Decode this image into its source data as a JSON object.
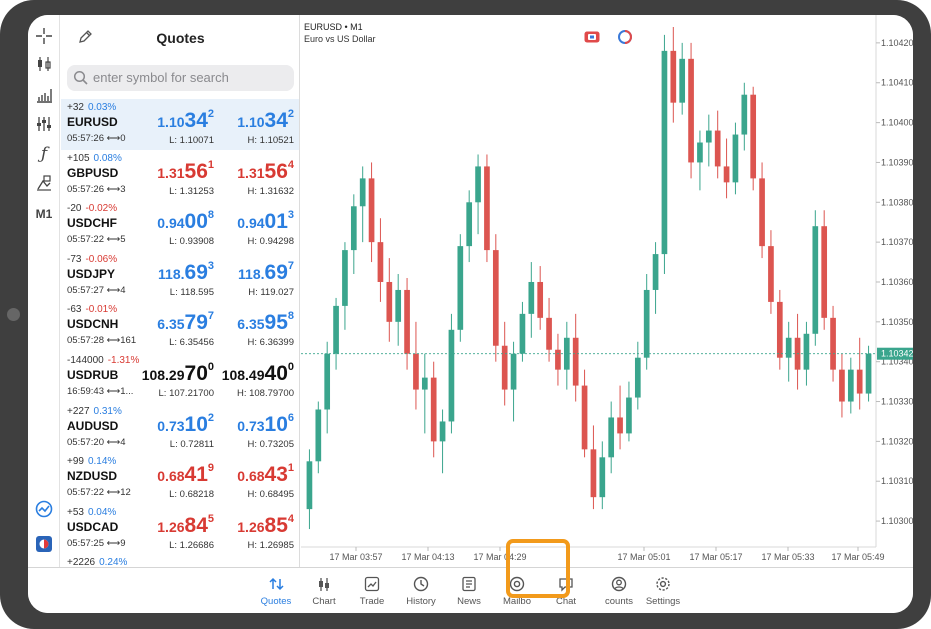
{
  "toolbar_icons": [
    "crosshair-icon",
    "candlestick-icon",
    "bar-chart-icon",
    "indicators-icon",
    "function-icon",
    "objects-icon",
    "timeframe-label"
  ],
  "timeframe": "M1",
  "side_bottom_icons": [
    "trading-signals-icon",
    "broker-icon"
  ],
  "quotes": {
    "title": "Quotes",
    "search_placeholder": "enter symbol for search",
    "rows": [
      {
        "change": "+32",
        "pct": "0.03%",
        "pct_color": "#2a7ee0",
        "symbol": "EURUSD",
        "time": "05:57:26",
        "spread": "0",
        "bid_a": "1.10",
        "bid_b": "34",
        "bid_c": "2",
        "ask_a": "1.10",
        "ask_b": "34",
        "ask_c": "2",
        "color": "blue",
        "low": "L: 1.10071",
        "high": "H: 1.10521"
      },
      {
        "change": "+105",
        "pct": "0.08%",
        "pct_color": "#2a7ee0",
        "symbol": "GBPUSD",
        "time": "05:57:26",
        "spread": "3",
        "bid_a": "1.31",
        "bid_b": "56",
        "bid_c": "1",
        "ask_a": "1.31",
        "ask_b": "56",
        "ask_c": "4",
        "color": "red",
        "low": "L: 1.31253",
        "high": "H: 1.31632"
      },
      {
        "change": "-20",
        "pct": "-0.02%",
        "pct_color": "#d83a33",
        "symbol": "USDCHF",
        "time": "05:57:22",
        "spread": "5",
        "bid_a": "0.94",
        "bid_b": "00",
        "bid_c": "8",
        "ask_a": "0.94",
        "ask_b": "01",
        "ask_c": "3",
        "color": "blue",
        "low": "L: 0.93908",
        "high": "H: 0.94298"
      },
      {
        "change": "-73",
        "pct": "-0.06%",
        "pct_color": "#d83a33",
        "symbol": "USDJPY",
        "time": "05:57:27",
        "spread": "4",
        "bid_a": "118.",
        "bid_b": "69",
        "bid_c": "3",
        "ask_a": "118.",
        "ask_b": "69",
        "ask_c": "7",
        "color": "blue",
        "low": "L: 118.595",
        "high": "H: 119.027"
      },
      {
        "change": "-63",
        "pct": "-0.01%",
        "pct_color": "#d83a33",
        "symbol": "USDCNH",
        "time": "05:57:28",
        "spread": "161",
        "bid_a": "6.35",
        "bid_b": "79",
        "bid_c": "7",
        "ask_a": "6.35",
        "ask_b": "95",
        "ask_c": "8",
        "color": "blue",
        "low": "L: 6.35456",
        "high": "H: 6.36399"
      },
      {
        "change": "-144000",
        "pct": "-1.31%",
        "pct_color": "#d83a33",
        "symbol": "USDRUB",
        "time": "16:59:43",
        "spread": "1...",
        "bid_a": "108.29",
        "bid_b": "70",
        "bid_c": "0",
        "ask_a": "108.49",
        "ask_b": "40",
        "ask_c": "0",
        "color": "dark",
        "low": "L: 107.21700",
        "high": "H: 108.79700"
      },
      {
        "change": "+227",
        "pct": "0.31%",
        "pct_color": "#2a7ee0",
        "symbol": "AUDUSD",
        "time": "05:57:20",
        "spread": "4",
        "bid_a": "0.73",
        "bid_b": "10",
        "bid_c": "2",
        "ask_a": "0.73",
        "ask_b": "10",
        "ask_c": "6",
        "color": "blue",
        "low": "L: 0.72811",
        "high": "H: 0.73205"
      },
      {
        "change": "+99",
        "pct": "0.14%",
        "pct_color": "#2a7ee0",
        "symbol": "NZDUSD",
        "time": "05:57:22",
        "spread": "12",
        "bid_a": "0.68",
        "bid_b": "41",
        "bid_c": "9",
        "ask_a": "0.68",
        "ask_b": "43",
        "ask_c": "1",
        "color": "red",
        "low": "L: 0.68218",
        "high": "H: 0.68495"
      },
      {
        "change": "+53",
        "pct": "0.04%",
        "pct_color": "#2a7ee0",
        "symbol": "USDCAD",
        "time": "05:57:25",
        "spread": "9",
        "bid_a": "1.26",
        "bid_b": "84",
        "bid_c": "5",
        "ask_a": "1.26",
        "ask_b": "85",
        "ask_c": "4",
        "color": "red",
        "low": "L: 1.26686",
        "high": "H: 1.26985"
      },
      {
        "change": "+2226",
        "pct": "0.24%",
        "pct_color": "#2a7ee0",
        "symbol": "",
        "time": "",
        "spread": "",
        "bid_a": "",
        "bid_b": "",
        "bid_c": "",
        "ask_a": "",
        "ask_b": "",
        "ask_c": "",
        "color": "blue",
        "low": "",
        "high": ""
      }
    ]
  },
  "chart": {
    "symbol_line": "EURUSD • M1",
    "description": "Euro vs US Dollar",
    "price_labels": [
      "1.10420",
      "1.10410",
      "1.10400",
      "1.10390",
      "1.10380",
      "1.10370",
      "1.10360",
      "1.10350",
      "1.10340",
      "1.10330",
      "1.10320",
      "1.10310",
      "1.10300"
    ],
    "current_price": "1.10342",
    "time_labels": [
      "17 Mar 03:57",
      "17 Mar 04:13",
      "17 Mar 04:29",
      "17 Mar 05:01",
      "17 Mar 05:17",
      "17 Mar 05:33",
      "17 Mar 05:49"
    ],
    "bull_color": "#3aa58d",
    "bear_color": "#dc5550"
  },
  "chart_data": {
    "type": "candlestick",
    "title": "EURUSD • M1",
    "subtitle": "Euro vs US Dollar",
    "ylim": [
      1.10295,
      1.10427
    ],
    "current_price": 1.10342,
    "candles": [
      [
        1.10303,
        1.10318,
        1.10298,
        1.10315
      ],
      [
        1.10315,
        1.1033,
        1.10312,
        1.10328
      ],
      [
        1.10328,
        1.10345,
        1.10322,
        1.10342
      ],
      [
        1.10342,
        1.10356,
        1.10338,
        1.10354
      ],
      [
        1.10354,
        1.1037,
        1.10348,
        1.10368
      ],
      [
        1.10368,
        1.10382,
        1.10362,
        1.10379
      ],
      [
        1.10379,
        1.10389,
        1.1037,
        1.10386
      ],
      [
        1.10386,
        1.1039,
        1.10365,
        1.1037
      ],
      [
        1.1037,
        1.10376,
        1.10355,
        1.1036
      ],
      [
        1.1036,
        1.10366,
        1.10345,
        1.1035
      ],
      [
        1.1035,
        1.10362,
        1.10344,
        1.10358
      ],
      [
        1.10358,
        1.10361,
        1.10338,
        1.10342
      ],
      [
        1.10342,
        1.1035,
        1.10328,
        1.10333
      ],
      [
        1.10333,
        1.10342,
        1.10322,
        1.10336
      ],
      [
        1.10336,
        1.1034,
        1.10316,
        1.1032
      ],
      [
        1.1032,
        1.10328,
        1.10312,
        1.10325
      ],
      [
        1.10325,
        1.10352,
        1.10322,
        1.10348
      ],
      [
        1.10348,
        1.10372,
        1.10345,
        1.10369
      ],
      [
        1.10369,
        1.10383,
        1.10365,
        1.1038
      ],
      [
        1.1038,
        1.10392,
        1.10372,
        1.10389
      ],
      [
        1.10389,
        1.10392,
        1.10365,
        1.10368
      ],
      [
        1.10368,
        1.10372,
        1.1034,
        1.10344
      ],
      [
        1.10344,
        1.1035,
        1.10329,
        1.10333
      ],
      [
        1.10333,
        1.10345,
        1.10325,
        1.10342
      ],
      [
        1.10342,
        1.10355,
        1.1034,
        1.10352
      ],
      [
        1.10352,
        1.10365,
        1.10346,
        1.1036
      ],
      [
        1.1036,
        1.10364,
        1.10348,
        1.10351
      ],
      [
        1.10351,
        1.10356,
        1.1034,
        1.10343
      ],
      [
        1.10343,
        1.10347,
        1.10334,
        1.10338
      ],
      [
        1.10338,
        1.1035,
        1.10333,
        1.10346
      ],
      [
        1.10346,
        1.10352,
        1.1033,
        1.10334
      ],
      [
        1.10334,
        1.10338,
        1.10316,
        1.10318
      ],
      [
        1.10318,
        1.10324,
        1.10303,
        1.10306
      ],
      [
        1.10306,
        1.1032,
        1.10303,
        1.10316
      ],
      [
        1.10316,
        1.1033,
        1.10312,
        1.10326
      ],
      [
        1.10326,
        1.10334,
        1.10318,
        1.10322
      ],
      [
        1.10322,
        1.10335,
        1.1032,
        1.10331
      ],
      [
        1.10331,
        1.10345,
        1.10328,
        1.10341
      ],
      [
        1.10341,
        1.10362,
        1.10338,
        1.10358
      ],
      [
        1.10358,
        1.1037,
        1.10352,
        1.10367
      ],
      [
        1.10367,
        1.10422,
        1.10362,
        1.10418
      ],
      [
        1.10418,
        1.10424,
        1.104,
        1.10405
      ],
      [
        1.10405,
        1.1042,
        1.10402,
        1.10416
      ],
      [
        1.10416,
        1.1042,
        1.10386,
        1.1039
      ],
      [
        1.1039,
        1.10398,
        1.10383,
        1.10395
      ],
      [
        1.10395,
        1.10402,
        1.10389,
        1.10398
      ],
      [
        1.10398,
        1.10403,
        1.10386,
        1.10389
      ],
      [
        1.10389,
        1.10396,
        1.10381,
        1.10385
      ],
      [
        1.10385,
        1.104,
        1.10382,
        1.10397
      ],
      [
        1.10397,
        1.1041,
        1.10393,
        1.10407
      ],
      [
        1.10407,
        1.10409,
        1.10383,
        1.10386
      ],
      [
        1.10386,
        1.1039,
        1.10366,
        1.10369
      ],
      [
        1.10369,
        1.10373,
        1.10352,
        1.10355
      ],
      [
        1.10355,
        1.10358,
        1.10338,
        1.10341
      ],
      [
        1.10341,
        1.1035,
        1.10335,
        1.10346
      ],
      [
        1.10346,
        1.10352,
        1.10333,
        1.10338
      ],
      [
        1.10338,
        1.1035,
        1.10334,
        1.10347
      ],
      [
        1.10347,
        1.10378,
        1.10344,
        1.10374
      ],
      [
        1.10374,
        1.10378,
        1.10348,
        1.10351
      ],
      [
        1.10351,
        1.10354,
        1.10335,
        1.10338
      ],
      [
        1.10338,
        1.10342,
        1.10326,
        1.1033
      ],
      [
        1.1033,
        1.10341,
        1.10327,
        1.10338
      ],
      [
        1.10338,
        1.10346,
        1.10328,
        1.10332
      ],
      [
        1.10332,
        1.10344,
        1.1033,
        1.10342
      ]
    ]
  },
  "tabs": [
    {
      "label": "Quotes",
      "icon": "quotes-icon",
      "active": true
    },
    {
      "label": "Chart",
      "icon": "chart-icon",
      "active": false
    },
    {
      "label": "Trade",
      "icon": "trade-icon",
      "active": false
    },
    {
      "label": "History",
      "icon": "history-icon",
      "active": false
    },
    {
      "label": "News",
      "icon": "news-icon",
      "active": false
    },
    {
      "label": "Mailbo",
      "icon": "mailbox-icon",
      "active": false
    },
    {
      "label": "Chat",
      "icon": "chat-icon",
      "active": false
    },
    {
      "label": "counts",
      "icon": "accounts-icon",
      "active": false
    },
    {
      "label": "Settings",
      "icon": "settings-icon",
      "active": false
    }
  ]
}
